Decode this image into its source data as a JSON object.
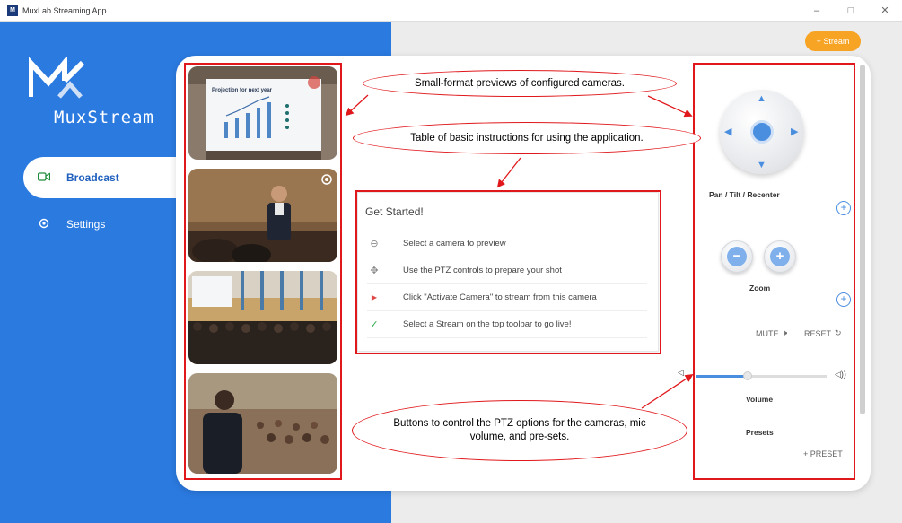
{
  "window": {
    "title": "MuxLab Streaming App",
    "app_icon_text": "M",
    "minimize": "–",
    "maximize": "□",
    "close": "✕"
  },
  "logo": {
    "text": "MuxStream"
  },
  "nav": {
    "items": [
      {
        "label": "Broadcast",
        "icon": "camera-icon",
        "active": true
      },
      {
        "label": "Settings",
        "icon": "gear-icon",
        "active": false
      }
    ]
  },
  "toolbar": {
    "stream_button": "+ Stream"
  },
  "thumbnails": {
    "slide_title": "Projection for next year"
  },
  "get_started": {
    "title": "Get Started!",
    "rows": [
      {
        "icon": "arrow-left-circle-icon",
        "symbol": "⊖",
        "text": "Select a camera to preview"
      },
      {
        "icon": "move-icon",
        "symbol": "✥",
        "text": "Use the PTZ controls to prepare your shot"
      },
      {
        "icon": "play-circle-icon",
        "symbol": "▶",
        "text": "Click \"Activate Camera\" to stream from this camera"
      },
      {
        "icon": "check-circle-icon",
        "symbol": "✓",
        "text": "Select a Stream on the top toolbar to go live!"
      }
    ]
  },
  "controls": {
    "pan_label": "Pan / Tilt / Recenter",
    "zoom_label": "Zoom",
    "zoom_minus": "−",
    "zoom_plus": "+",
    "mute_label": "MUTE",
    "reset_label": "RESET",
    "volume_label": "Volume",
    "volume_level": 0.4,
    "presets_label": "Presets",
    "add_preset_label": "+ PRESET"
  },
  "annotations": {
    "previews": "Small-format previews of configured cameras.",
    "instructions": "Table of basic instructions for using the application.",
    "buttons": "Buttons to control the PTZ options for the cameras, mic volume, and pre-sets."
  },
  "colors": {
    "sidebar": "#2b7ae0",
    "accent": "#4a8ee0",
    "stream_button": "#f7a323",
    "annotation": "#e0181c"
  }
}
